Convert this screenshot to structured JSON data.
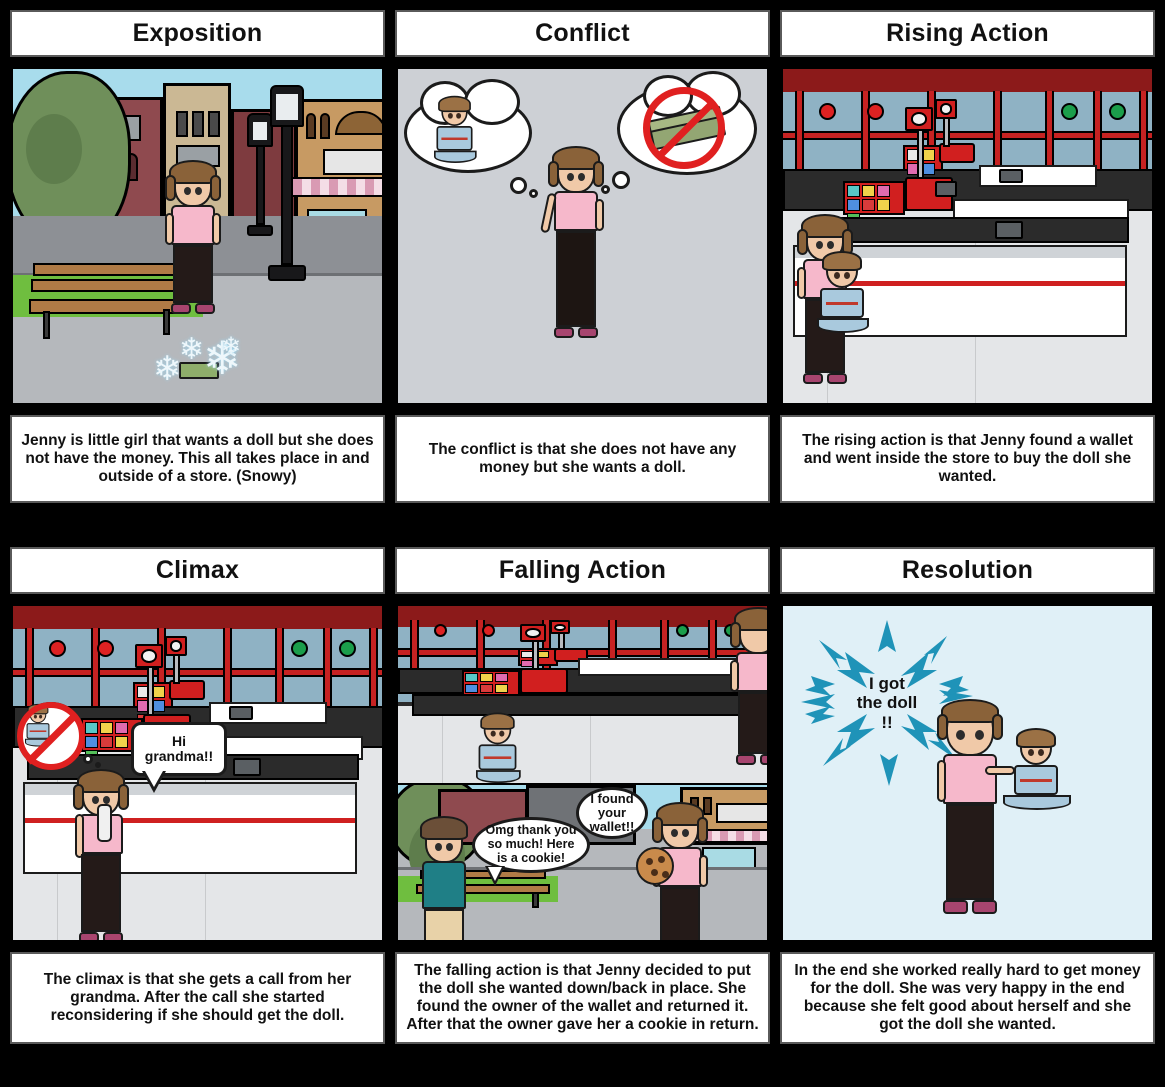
{
  "board": {
    "background_color": "#000000",
    "panel_border_color": "#5a5a5a",
    "panel_fill_color": "#ffffff"
  },
  "panels": [
    {
      "id": "exposition",
      "title": "Exposition",
      "caption": "Jenny is little girl that wants a doll but she does not have the money. This all takes place in and outside of a store. (Snowy)",
      "scene": {
        "setting": "town street outside store, snowy, daytime",
        "background_colors": {
          "sky": "#a8dcec",
          "sidewalk": "#b9bcc0",
          "road": "#6f7276",
          "grass": "#6fbe3f"
        },
        "objects": [
          "tree",
          "storefront-buildings",
          "street-lamp",
          "park-bench",
          "snowflakes",
          "wallet-on-ground"
        ],
        "characters": [
          {
            "name": "jenny",
            "shirt_color": "#f6b8cb",
            "pants_color": "#241a18"
          }
        ],
        "bubbles": []
      }
    },
    {
      "id": "conflict",
      "title": "Conflict",
      "caption": "The conflict  is that she does not have any money but she wants a doll.",
      "scene": {
        "setting": "plain gray background, thinking",
        "background_colors": {
          "flat": "#cdd0d5"
        },
        "objects": [
          "thought-bubble-doll",
          "thought-bubble-no-money"
        ],
        "characters": [
          {
            "name": "jenny",
            "shirt_color": "#f6b8cb",
            "pants_color": "#1d1512"
          }
        ],
        "bubbles": [
          {
            "type": "thought",
            "content": "doll"
          },
          {
            "type": "thought",
            "content": "money-crossed-out"
          }
        ]
      }
    },
    {
      "id": "rising-action",
      "title": "Rising Action",
      "caption": "The rising action is that Jenny found a wallet and went inside the store to buy the doll she wanted.",
      "scene": {
        "setting": "store checkout lanes",
        "background_colors": {
          "wall": "#8c1a1a",
          "glass": "#8fb2c4",
          "floor": "#e4e6e8",
          "accent": "#c62222"
        },
        "objects": [
          "checkout-counter",
          "cash-register",
          "candy-rack",
          "lane-sign",
          "conveyor-belt"
        ],
        "characters": [
          {
            "name": "jenny",
            "shirt_color": "#f6b8cb",
            "pants_color": "#241a18"
          },
          {
            "name": "doll",
            "dress_color": "#a9c9dd"
          }
        ],
        "bubbles": []
      }
    },
    {
      "id": "climax",
      "title": "Climax",
      "caption": "The climax is that she gets a call from her grandma. After the call she started reconsidering if she should get the doll.",
      "scene": {
        "setting": "store checkout lanes, phone call",
        "background_colors": {
          "wall": "#8c1a1a",
          "glass": "#8fb2c4",
          "floor": "#e4e6e8",
          "accent": "#c62222"
        },
        "objects": [
          "checkout-counter",
          "cash-register",
          "candy-rack",
          "lane-sign",
          "thought-bubble-no-doll"
        ],
        "characters": [
          {
            "name": "jenny",
            "shirt_color": "#f6b8cb",
            "pants_color": "#241a18"
          }
        ],
        "bubbles": [
          {
            "type": "speech",
            "text": "Hi grandma!!"
          },
          {
            "type": "thought",
            "content": "doll-crossed-out"
          }
        ]
      }
    },
    {
      "id": "falling-action",
      "title": "Falling Action",
      "caption": "The falling action is that Jenny decided to put the doll she wanted down/back in place. She found the owner of the wallet and returned it. After that the owner gave her a cookie in return.",
      "scene": {
        "setting": "split panel: store above, street below",
        "background_colors": {
          "wall": "#8c1a1a",
          "glass": "#8fb2c4",
          "floor": "#e4e6e8",
          "sky": "#a8dcec",
          "sidewalk": "#b9bcc0"
        },
        "objects": [
          "checkout-counter",
          "candy-rack",
          "lane-sign",
          "doll-left-on-counter",
          "park-bench",
          "tree",
          "cookie"
        ],
        "characters": [
          {
            "name": "jenny",
            "shirt_color": "#f6b8cb",
            "pants_color": "#241a18"
          },
          {
            "name": "wallet-owner",
            "dress_color": "#1f7f86"
          },
          {
            "name": "doll",
            "dress_color": "#a9c9dd"
          }
        ],
        "bubbles": [
          {
            "type": "speech",
            "text": "I found your wallet!!"
          },
          {
            "type": "speech",
            "text": "Omg thank you so much! Here is a cookie!"
          }
        ]
      }
    },
    {
      "id": "resolution",
      "title": "Resolution",
      "caption": "In the end she worked really hard to get money for the doll. She was very happy in the end because she felt good about herself and she got the doll she wanted.",
      "scene": {
        "setting": "plain light blue background, celebration",
        "background_colors": {
          "flat": "#e0f0f7",
          "burst": "#1f93b8"
        },
        "objects": [
          "burst-starburst"
        ],
        "characters": [
          {
            "name": "jenny",
            "shirt_color": "#f6b8cb",
            "pants_color": "#241a18"
          },
          {
            "name": "doll",
            "dress_color": "#a9c9dd"
          }
        ],
        "bubbles": [
          {
            "type": "burst",
            "text": "I got the doll !!"
          }
        ]
      }
    }
  ],
  "bubble_text": {
    "climax_speech": "Hi grandma!!",
    "falling_found": "I found your wallet!!",
    "falling_thanks": "Omg thank you so much! Here is a cookie!",
    "resolution_line1": "I got",
    "resolution_line2": "the doll",
    "resolution_line3": "!!"
  }
}
